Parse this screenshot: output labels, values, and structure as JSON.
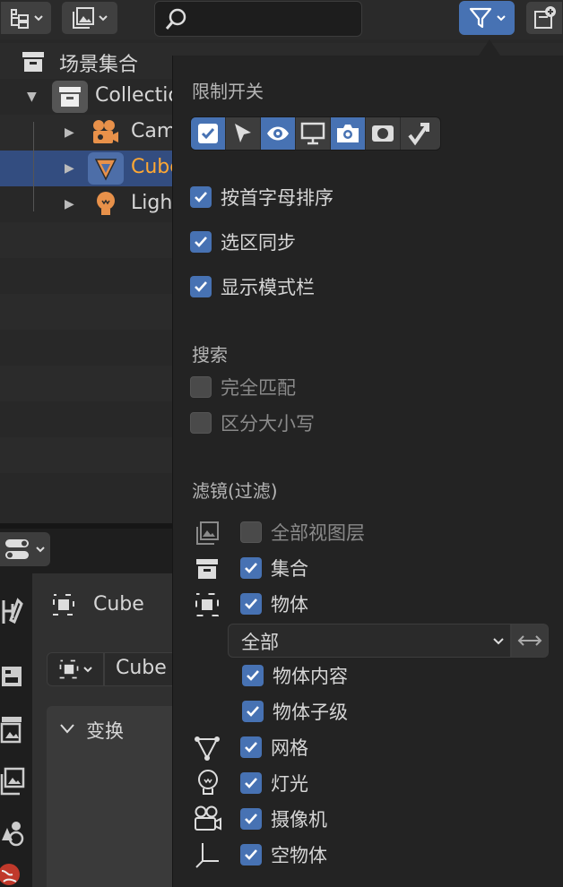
{
  "outliner": {
    "items": [
      {
        "label": "场景集合"
      },
      {
        "label": "Collection"
      },
      {
        "label": "Camera"
      },
      {
        "label": "Cube"
      },
      {
        "label": "Light"
      }
    ]
  },
  "properties": {
    "object_name": "Cube",
    "object_field": "Cube",
    "transform_label": "变换"
  },
  "popover": {
    "restriction_title": "限制开关",
    "options": [
      {
        "label": "按首字母排序",
        "checked": true
      },
      {
        "label": "选区同步",
        "checked": true
      },
      {
        "label": "显示模式栏",
        "checked": true
      }
    ],
    "search_title": "搜索",
    "search_options": [
      {
        "label": "完全匹配",
        "checked": false
      },
      {
        "label": "区分大小写",
        "checked": false
      }
    ],
    "filter_title": "滤镜(过滤)",
    "filters": {
      "all_view_layers": "全部视图层",
      "collections": "集合",
      "objects": "物体",
      "object_type_select": "全部",
      "object_contents": "物体内容",
      "object_children": "物体子级",
      "meshes": "网格",
      "lights": "灯光",
      "cameras": "摄像机",
      "empties": "空物体"
    }
  },
  "colors": {
    "accent": "#4772b3",
    "selected_row": "#334d80",
    "active_object_text": "#ffa833",
    "object_icon": "#e8914a"
  }
}
